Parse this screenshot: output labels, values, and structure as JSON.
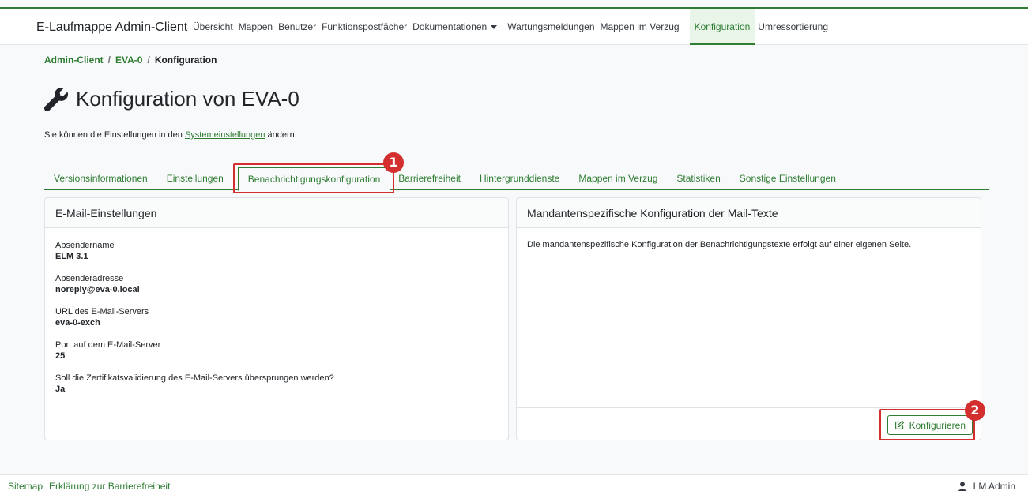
{
  "app": {
    "title": "E-Laufmappe Admin-Client"
  },
  "nav": {
    "items": [
      {
        "label": "Übersicht"
      },
      {
        "label": "Mappen"
      },
      {
        "label": "Benutzer"
      },
      {
        "label": "Funktionspostfächer"
      },
      {
        "label": "Dokumentationen"
      },
      {
        "label": "Wartungsmeldungen"
      },
      {
        "label": "Mappen im Verzug"
      },
      {
        "label": "Konfiguration"
      },
      {
        "label": "Umressortierung"
      }
    ],
    "active": "Konfiguration"
  },
  "breadcrumb": {
    "items": [
      "Admin-Client",
      "EVA-0",
      "Konfiguration"
    ],
    "separator": "/"
  },
  "page": {
    "title": "Konfiguration von EVA-0",
    "subtitle_prefix": "Sie können die Einstellungen in den ",
    "subtitle_link": "Systemeinstellungen",
    "subtitle_suffix": " ändern"
  },
  "tabs": {
    "items": [
      {
        "label": "Versionsinformationen"
      },
      {
        "label": "Einstellungen"
      },
      {
        "label": "Benachrichtigungskonfiguration"
      },
      {
        "label": "Barrierefreiheit"
      },
      {
        "label": "Hintergrunddienste"
      },
      {
        "label": "Mappen im Verzug"
      },
      {
        "label": "Statistiken"
      },
      {
        "label": "Sonstige Einstellungen"
      }
    ],
    "active": "Benachrichtigungskonfiguration"
  },
  "email_card": {
    "title": "E-Mail-Einstellungen",
    "fields": [
      {
        "label": "Absendername",
        "value": "ELM 3.1"
      },
      {
        "label": "Absenderadresse",
        "value": "noreply@eva-0.local"
      },
      {
        "label": "URL des E-Mail-Servers",
        "value": "eva-0-exch"
      },
      {
        "label": "Port auf dem E-Mail-Server",
        "value": "25"
      },
      {
        "label": "Soll die Zertifikatsvalidierung des E-Mail-Servers übersprungen werden?",
        "value": "Ja"
      }
    ]
  },
  "mail_text_card": {
    "title": "Mandantenspezifische Konfiguration der Mail-Texte",
    "description": "Die mandantenspezifische Konfiguration der Benachrichtigungstexte erfolgt auf einer eigenen Seite.",
    "button_label": "Konfigurieren"
  },
  "annotations": {
    "step1": "1",
    "step2": "2",
    "color": "#d32f2f"
  },
  "footer": {
    "links": [
      "Sitemap",
      "Erklärung zur Barrierefreiheit"
    ],
    "user": "LM Admin"
  },
  "theme": {
    "accent": "#2e7d32"
  }
}
